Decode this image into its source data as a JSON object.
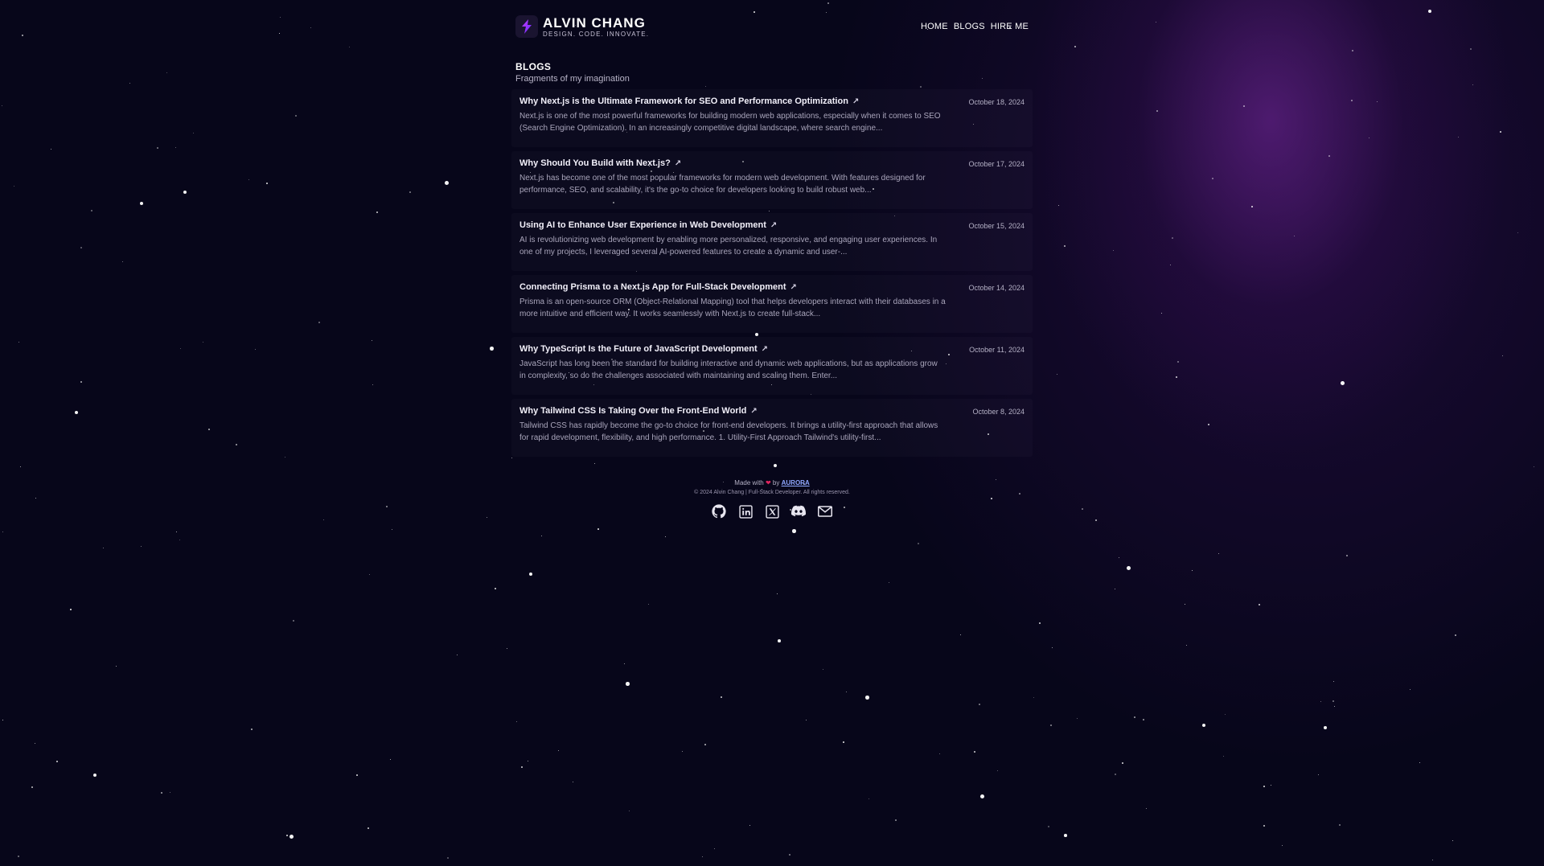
{
  "brand": {
    "name": "ALVIN CHANG",
    "tagline": "DESIGN. CODE. INNOVATE."
  },
  "nav": {
    "home": "HOME",
    "blogs": "BLOGS",
    "hire_me": "HIRE ME"
  },
  "page": {
    "title": "BLOGS",
    "subtitle": "Fragments of my imagination"
  },
  "posts": [
    {
      "title": "Why Next.js is the Ultimate Framework for SEO and Performance Optimization",
      "excerpt": "Next.js is one of the most powerful frameworks for building modern web applications, especially when it comes to SEO (Search Engine Optimization). In an increasingly competitive digital landscape, where search engine...",
      "date": "October 18, 2024"
    },
    {
      "title": "Why Should You Build with Next.js?",
      "excerpt": "Next.js has become one of the most popular frameworks for modern web development. With features designed for performance, SEO, and scalability, it's the go-to choice for developers looking to build robust web...",
      "date": "October 17, 2024"
    },
    {
      "title": "Using AI to Enhance User Experience in Web Development",
      "excerpt": "AI is revolutionizing web development by enabling more personalized, responsive, and engaging user experiences. In one of my projects, I leveraged several AI-powered features to create a dynamic and user-...",
      "date": "October 15, 2024"
    },
    {
      "title": "Connecting Prisma to a Next.js App for Full-Stack Development",
      "excerpt": "Prisma is an open-source ORM (Object-Relational Mapping) tool that helps developers interact with their databases in a more intuitive and efficient way. It works seamlessly with Next.js to create full-stack...",
      "date": "October 14, 2024"
    },
    {
      "title": "Why TypeScript Is the Future of JavaScript Development",
      "excerpt": "JavaScript has long been the standard for building interactive and dynamic web applications, but as applications grow in complexity, so do the challenges associated with maintaining and scaling them. Enter...",
      "date": "October 11, 2024"
    },
    {
      "title": "Why Tailwind CSS Is Taking Over the Front-End World",
      "excerpt": "Tailwind CSS has rapidly become the go-to choice for front-end developers. It brings a utility-first approach that allows for rapid development, flexibility, and high performance. 1. Utility-First Approach Tailwind's utility-first...",
      "date": "October 8, 2024"
    }
  ],
  "footer": {
    "made_with": "Made with",
    "by": "by",
    "aurora": "AURORA",
    "copyright": "© 2024 Alvin Chang | Full-Stack Developer. All rights reserved."
  },
  "socials": [
    "github-icon",
    "linkedin-icon",
    "x-icon",
    "discord-icon",
    "mail-icon"
  ],
  "colors": {
    "background": "#07061a",
    "glow": "#782aa0",
    "link": "#8fa8ff",
    "heart": "#e0245e"
  }
}
